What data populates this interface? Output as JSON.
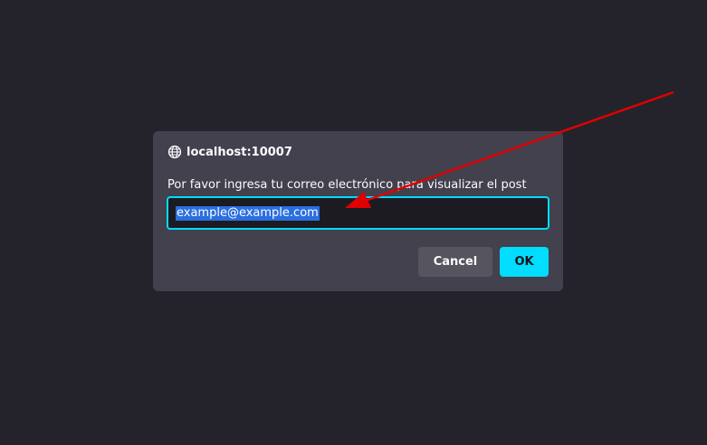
{
  "dialog": {
    "origin": "localhost:10007",
    "message": "Por favor ingresa tu correo electrónico para visualizar el post",
    "input_value": "example@example.com",
    "cancel_label": "Cancel",
    "ok_label": "OK"
  },
  "icons": {
    "origin": "globe-icon"
  },
  "colors": {
    "background": "#24232b",
    "dialog": "#42414d",
    "accent": "#00ddff",
    "selection": "#2a6ee0",
    "annotation_arrow": "#e00000"
  }
}
